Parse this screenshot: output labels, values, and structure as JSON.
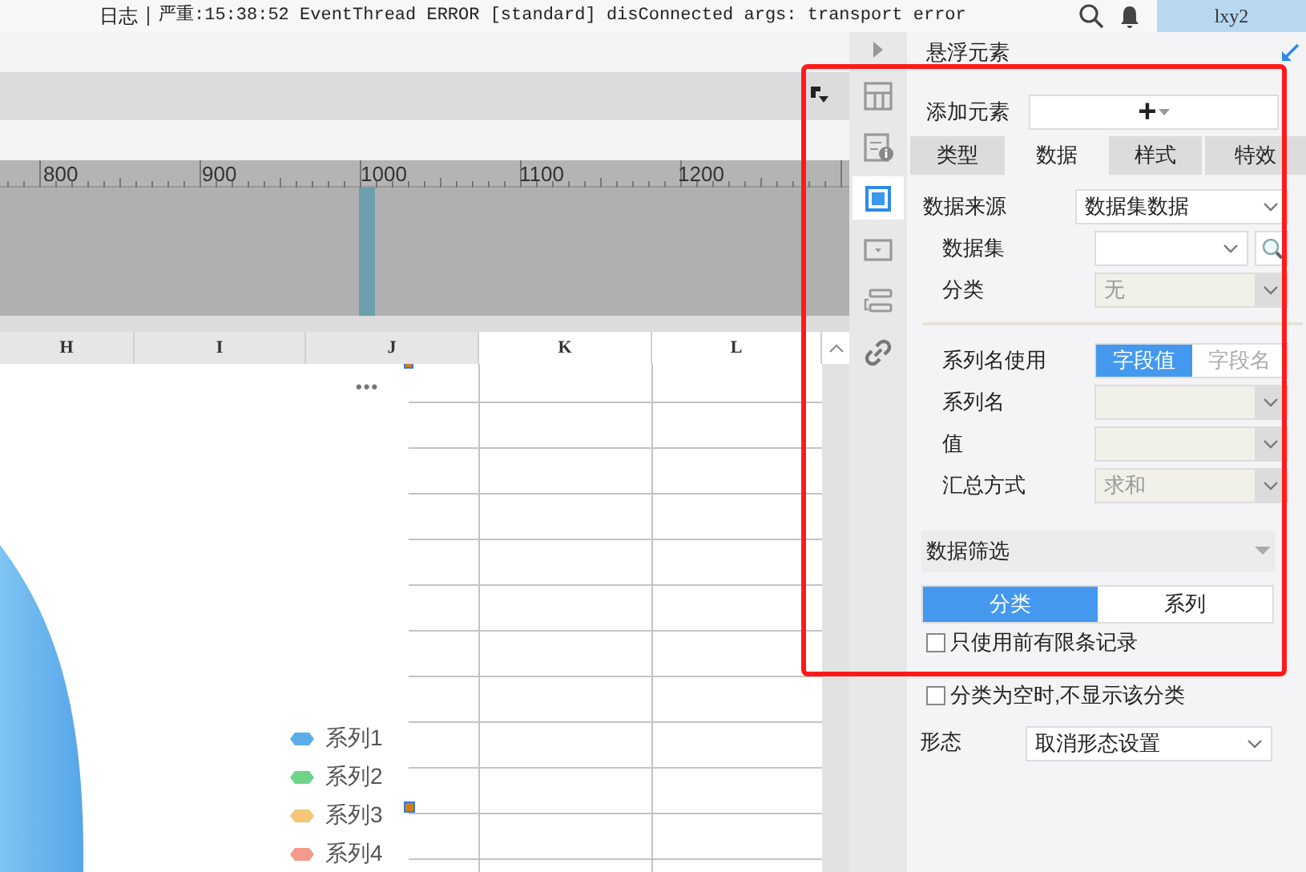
{
  "log_bar": {
    "label": "日志",
    "message": "严重:15:38:52 EventThread ERROR [standard] disConnected args: transport error"
  },
  "user": "lxy2",
  "ruler": {
    "ticks": [
      "800",
      "900",
      "1000",
      "1100",
      "1200"
    ]
  },
  "columns": [
    {
      "label": "H",
      "selected": true
    },
    {
      "label": "I",
      "selected": true
    },
    {
      "label": "J",
      "selected": true
    },
    {
      "label": "K",
      "selected": false
    },
    {
      "label": "L",
      "selected": false
    }
  ],
  "chart": {
    "more": "•••",
    "legend": [
      {
        "label": "系列1",
        "color": "#5aaeea"
      },
      {
        "label": "系列2",
        "color": "#6dd48a"
      },
      {
        "label": "系列3",
        "color": "#f5c678"
      },
      {
        "label": "系列4",
        "color": "#f39a8c"
      }
    ]
  },
  "side_icons": [
    {
      "kind": "layout",
      "selected": false
    },
    {
      "kind": "info",
      "selected": false
    },
    {
      "kind": "frame",
      "selected": true
    },
    {
      "kind": "dropdown",
      "selected": false
    },
    {
      "kind": "stack",
      "selected": false
    },
    {
      "kind": "link",
      "selected": false
    }
  ],
  "panel": {
    "title": "悬浮元素",
    "add_element": {
      "label": "添加元素",
      "button": "+"
    },
    "tabs": [
      {
        "label": "类型",
        "selected": false
      },
      {
        "label": "数据",
        "selected": true
      },
      {
        "label": "样式",
        "selected": false
      },
      {
        "label": "特效",
        "selected": false
      }
    ],
    "source": {
      "label": "数据来源",
      "value": "数据集数据",
      "kind": "select",
      "children": [
        {
          "label": "数据集",
          "kind": "search_select"
        },
        {
          "label": "分类",
          "value": "无",
          "kind": "disabled_select"
        }
      ]
    },
    "series_fields": [
      {
        "label": "系列名使用",
        "kind": "toggle",
        "options": [
          {
            "label": "字段值",
            "selected": true
          },
          {
            "label": "字段名",
            "selected": false
          }
        ]
      },
      {
        "label": "系列名",
        "kind": "disabled_select"
      },
      {
        "label": "值",
        "kind": "disabled_select"
      },
      {
        "label": "汇总方式",
        "kind": "disabled_select",
        "value": "求和"
      }
    ],
    "filter": {
      "title": "数据筛选",
      "segments": [
        {
          "label": "分类",
          "selected": true
        },
        {
          "label": "系列",
          "selected": false
        }
      ],
      "limit": {
        "label": "只使用前有限条记录",
        "checked": false
      }
    },
    "hide_empty": {
      "label": "分类为空时,不显示该分类",
      "checked": false
    },
    "shape": {
      "label": "形态",
      "value": "取消形态设置"
    }
  }
}
